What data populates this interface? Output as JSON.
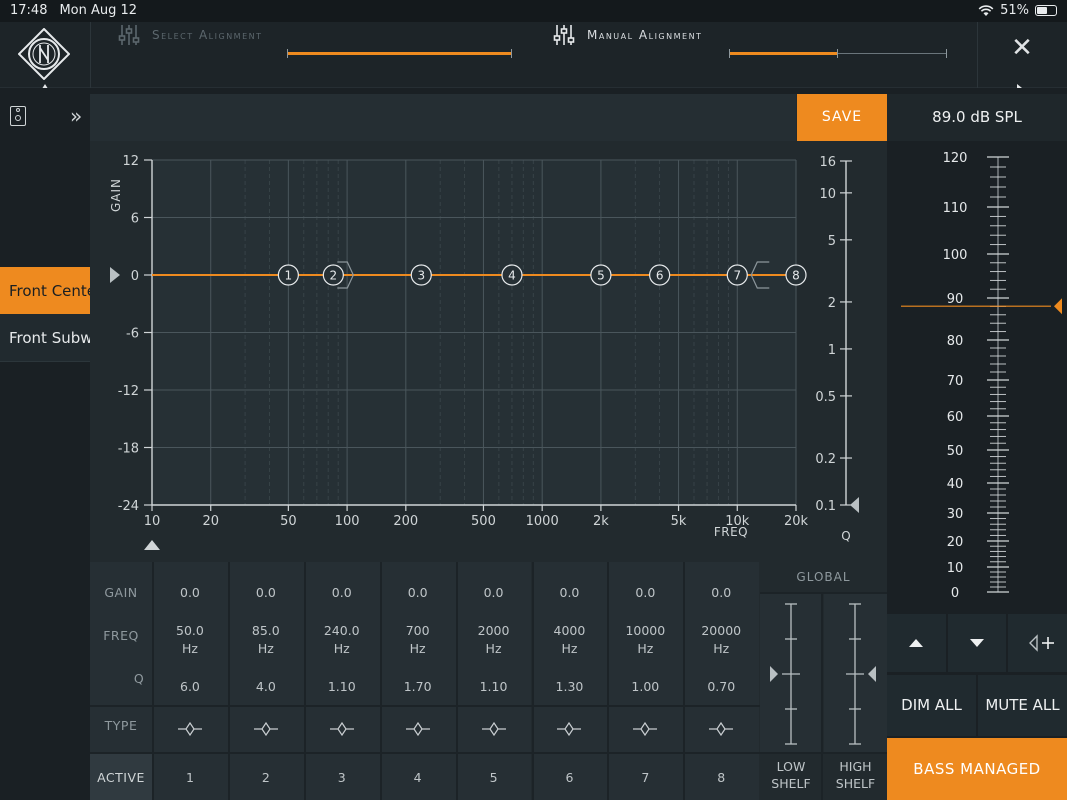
{
  "status": {
    "time": "17:48",
    "date": "Mon Aug 12",
    "battery": "51%"
  },
  "top": {
    "select_alignment": "Select Alignment",
    "manual_alignment": "Manual Alignment",
    "select_progress": 1.0,
    "manual_progress": 0.5
  },
  "speakers": [
    "Front Center",
    "Front Subwoofer"
  ],
  "save_label": "SAVE",
  "spl": "89.0 dB SPL",
  "graph": {
    "gain_label": "GAIN",
    "freq_label": "FREQ",
    "q_label": "Q",
    "gain_ticks": [
      "12",
      "6",
      "0",
      "-6",
      "-12",
      "-18",
      "-24"
    ],
    "freq_ticks": [
      "10",
      "20",
      "50",
      "100",
      "200",
      "500",
      "1000",
      "2k",
      "5k",
      "10k",
      "20k"
    ],
    "q_ticks": [
      "16",
      "10",
      "5",
      "2",
      "1",
      "0.5",
      "0.2",
      "0.1"
    ]
  },
  "table": {
    "row_labels": {
      "gain": "GAIN",
      "freq": "FREQ",
      "q": "Q",
      "type": "TYPE",
      "active": "ACTIVE"
    },
    "global_label": "GLOBAL",
    "low_shelf": "LOW\nSHELF",
    "high_shelf": "HIGH\nSHELF",
    "bands": [
      {
        "num": "1",
        "gain": "0.0",
        "freq": "50.0",
        "unit": "Hz",
        "q": "6.0"
      },
      {
        "num": "2",
        "gain": "0.0",
        "freq": "85.0",
        "unit": "Hz",
        "q": "4.0"
      },
      {
        "num": "3",
        "gain": "0.0",
        "freq": "240.0",
        "unit": "Hz",
        "q": "1.10"
      },
      {
        "num": "4",
        "gain": "0.0",
        "freq": "700",
        "unit": "Hz",
        "q": "1.70"
      },
      {
        "num": "5",
        "gain": "0.0",
        "freq": "2000",
        "unit": "Hz",
        "q": "1.10"
      },
      {
        "num": "6",
        "gain": "0.0",
        "freq": "4000",
        "unit": "Hz",
        "q": "1.30"
      },
      {
        "num": "7",
        "gain": "0.0",
        "freq": "10000",
        "unit": "Hz",
        "q": "1.00"
      },
      {
        "num": "8",
        "gain": "0.0",
        "freq": "20000",
        "unit": "Hz",
        "q": "0.70"
      }
    ]
  },
  "meter": {
    "labels": [
      "120",
      "110",
      "100",
      "90",
      "80",
      "70",
      "60",
      "50",
      "40",
      "30",
      "20",
      "10",
      "0"
    ],
    "level": 89.0
  },
  "buttons": {
    "dim_all": "DIM ALL",
    "mute_all": "MUTE ALL",
    "bass_managed": "BASS MANAGED"
  },
  "colors": {
    "accent": "#ee8a1f",
    "bg": "#1a2024",
    "panel": "#222a2e"
  },
  "icons": {
    "logo": "neumann-logo",
    "close": "close-icon",
    "speaker": "speaker-icon",
    "expand": "chevrons-right-icon"
  }
}
